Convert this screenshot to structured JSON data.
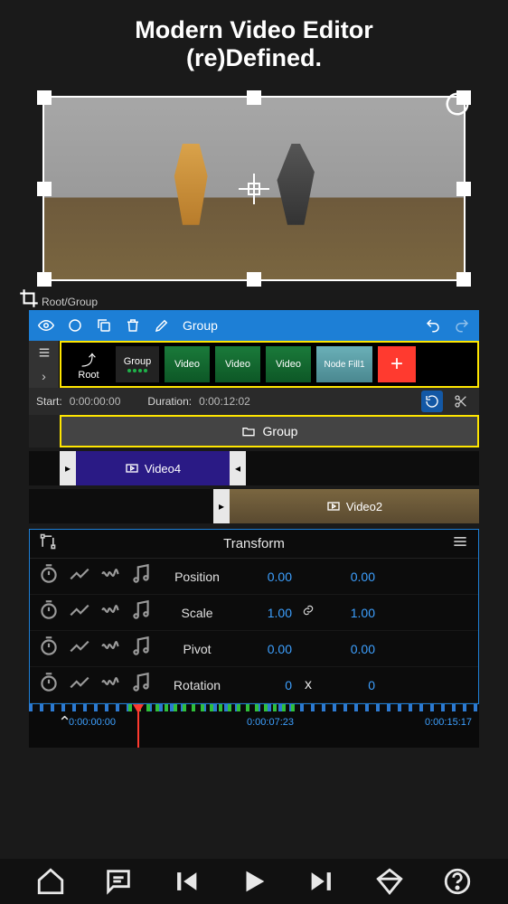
{
  "hero": {
    "line1": "Modern Video Editor",
    "line2": "(re)Defined."
  },
  "breadcrumb": "Root/Group",
  "toolbar": {
    "groupLabel": "Group"
  },
  "shelf": {
    "rootLabel": "Root",
    "groupLabel": "Group",
    "videoLabel": "Video",
    "nodeFillLabel": "Node Fill1",
    "addLabel": "+"
  },
  "meta": {
    "startLabel": "Start:",
    "startValue": "0:00:00:00",
    "durationLabel": "Duration:",
    "durationValue": "0:00:12:02"
  },
  "groupRow": {
    "label": "Group"
  },
  "clips": {
    "video4": "Video4",
    "video2": "Video2"
  },
  "transform": {
    "title": "Transform",
    "rows": [
      {
        "label": "Position",
        "v1": "0.00",
        "v2": "0.00",
        "link": false
      },
      {
        "label": "Scale",
        "v1": "1.00",
        "v2": "1.00",
        "link": true
      },
      {
        "label": "Pivot",
        "v1": "0.00",
        "v2": "0.00",
        "link": false
      },
      {
        "label": "Rotation",
        "v1": "0",
        "v2": "0",
        "xsep": true
      }
    ]
  },
  "ruler": {
    "t0": "0:00:00:00",
    "t1": "0:00:07:23",
    "t2": "0:00:15:17"
  }
}
